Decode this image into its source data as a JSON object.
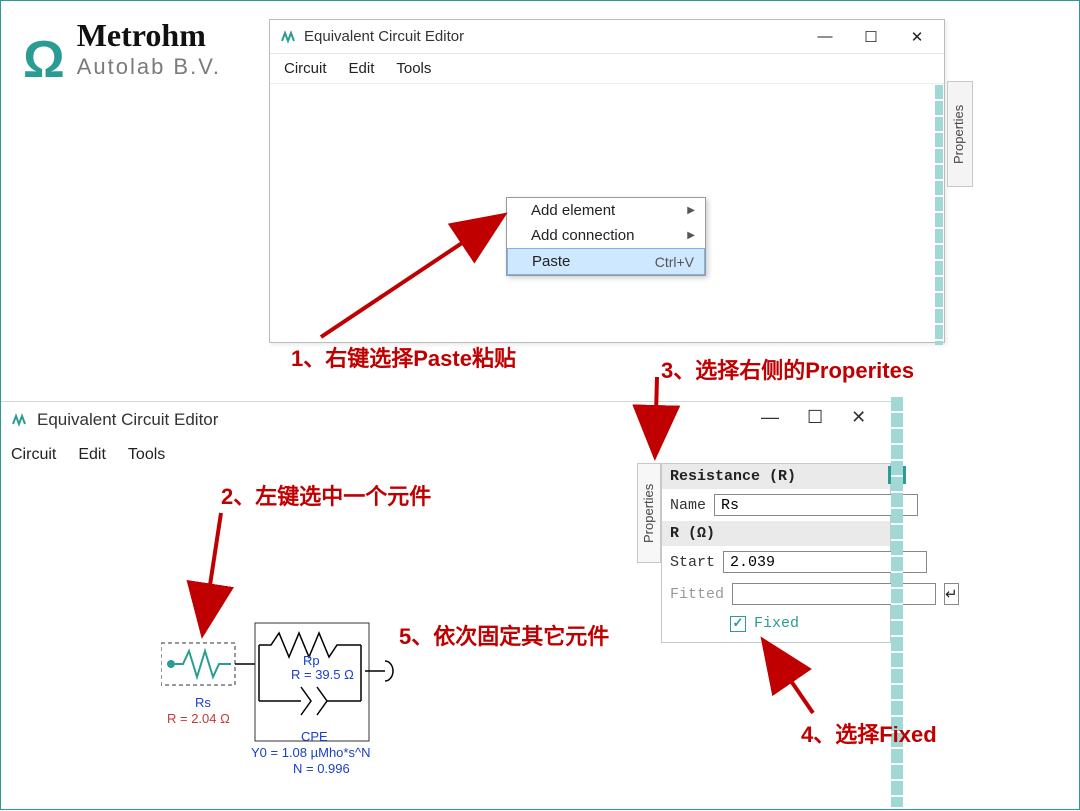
{
  "brand": {
    "name": "Metrohm",
    "sub": "Autolab B.V."
  },
  "win1": {
    "title": "Equivalent Circuit Editor",
    "menu": [
      "Circuit",
      "Edit",
      "Tools"
    ],
    "ctx": {
      "add_element": "Add element",
      "add_connection": "Add connection",
      "paste": "Paste",
      "paste_shortcut": "Ctrl+V"
    },
    "proptab": "Properties"
  },
  "win2": {
    "title": "Equivalent Circuit Editor",
    "menu": [
      "Circuit",
      "Edit",
      "Tools"
    ]
  },
  "circuit": {
    "rs_label": "Rs",
    "rs_val": "R = 2.04 Ω",
    "rp_label": "Rp",
    "rp_val": "R = 39.5 Ω",
    "cpe_label": "CPE",
    "cpe_y0": "Y0 = 1.08 µMho*s^N",
    "cpe_n": "N = 0.996"
  },
  "properties": {
    "tab": "Properties",
    "header": "Resistance (R)",
    "name_label": "Name",
    "name_value": "Rs",
    "r_section": "R (Ω)",
    "start_label": "Start",
    "start_value": "2.039",
    "fitted_label": "Fitted",
    "fitted_value": "",
    "fixed_label": "Fixed"
  },
  "annotations": {
    "a1": "1、右键选择Paste粘贴",
    "a2": "2、左键选中一个元件",
    "a3": "3、选择右侧的Properites",
    "a4": "4、选择Fixed",
    "a5": "5、依次固定其它元件"
  }
}
